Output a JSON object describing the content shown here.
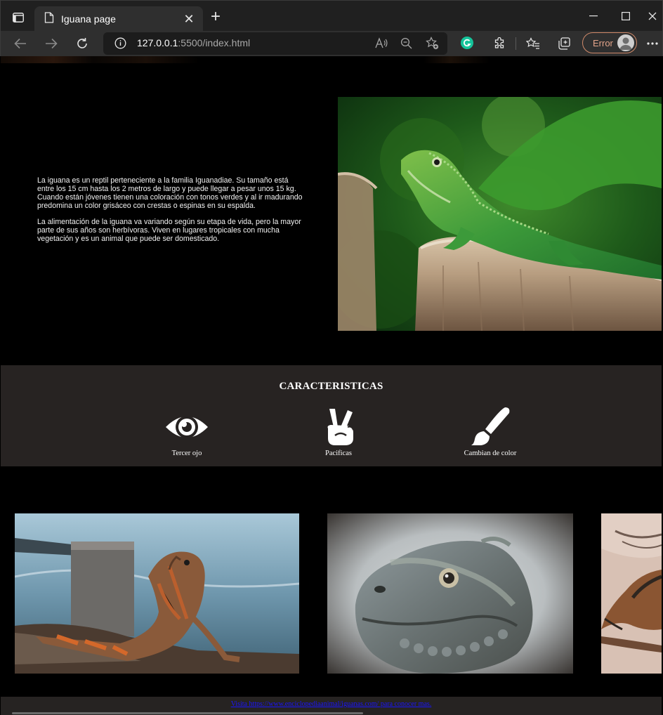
{
  "browser": {
    "tab_title": "Iguana page",
    "url_host": "127.0.0.1",
    "url_rest": ":5500/index.html",
    "profile_status": "Error",
    "icons": [
      "tab-actions-icon",
      "page-icon",
      "close-icon",
      "plus-icon",
      "minimize-icon",
      "maximize-icon",
      "close-window-icon",
      "back-icon",
      "forward-icon",
      "reload-icon",
      "info-icon",
      "read-aloud-icon",
      "zoom-icon",
      "add-favorite-icon",
      "grammarly-icon",
      "extensions-icon",
      "favorites-icon",
      "collections-icon",
      "profile-avatar",
      "more-icon"
    ]
  },
  "hero": {
    "paragraph_1": "La iguana es un reptil perteneciente a la familia Iguanadiae. Su tamaño está entre los 15 cm hasta los 2 metros de largo y puede llegar a pesar unos 15 kg. Cuando están jóvenes tienen una coloración con tonos verdes y al ir madurando predomina un color grisáceo con crestas o espinas en su espalda.",
    "paragraph_2": "La alimentación de la iguana va variando según su etapa de vida, pero la mayor parte de sus años son herbívoras. Viven en lugares tropicales con mucha vegetación y es un animal que puede ser domesticado."
  },
  "features": {
    "title": "CARACTERISTICAS",
    "items": [
      {
        "label": "Tercer ojo",
        "icon": "eye-icon"
      },
      {
        "label": "Pacificas",
        "icon": "peace-hand-icon"
      },
      {
        "label": "Cambian de color",
        "icon": "paintbrush-icon"
      }
    ]
  },
  "footer": {
    "link_text": "Visita https://www.enciclopediaanimal/iguanas.com/ para conocer mas."
  },
  "colors": {
    "page_bg": "#000000",
    "features_bg": "#272322",
    "footer_bg": "#262322",
    "link": "#1a14ff",
    "browser_titlebar": "#202020",
    "browser_toolbar": "#2f2f2f"
  }
}
